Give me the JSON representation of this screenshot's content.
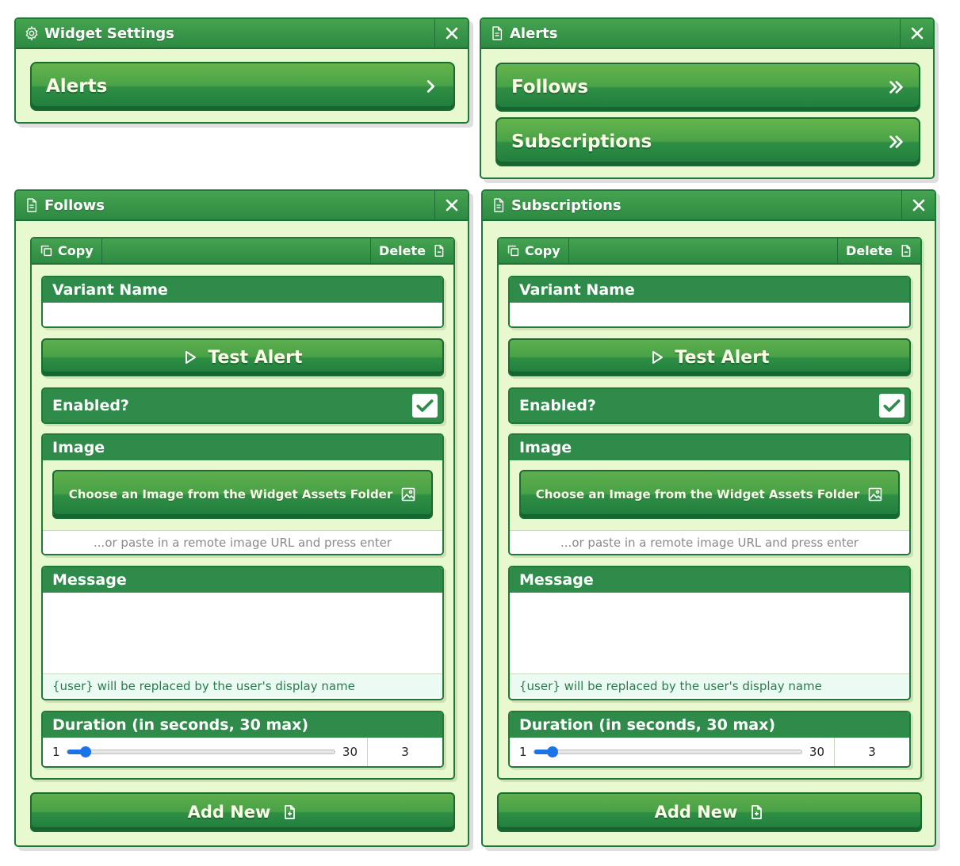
{
  "widget_settings": {
    "title": "Widget Settings",
    "title_icon": "gear-icon",
    "items": [
      {
        "label": "Alerts",
        "icon": "chevron-right-icon"
      }
    ]
  },
  "alerts": {
    "title": "Alerts",
    "title_icon": "document-icon",
    "items": [
      {
        "label": "Follows",
        "icon": "double-chevron-right-icon"
      },
      {
        "label": "Subscriptions",
        "icon": "double-chevron-right-icon"
      }
    ]
  },
  "editors": [
    {
      "title": "Follows",
      "title_icon": "document-icon",
      "copy_label": "Copy",
      "delete_label": "Delete",
      "variant_name_label": "Variant Name",
      "variant_name_value": "",
      "test_alert_label": "Test Alert",
      "enabled_label": "Enabled?",
      "enabled": true,
      "image_label": "Image",
      "choose_image_label": "Choose an Image from the Widget Assets Folder",
      "image_url_placeholder": "...or paste in a remote image URL and press enter",
      "message_label": "Message",
      "message_value": "",
      "message_hint": "{user} will be replaced by the user's display name",
      "duration_label": "Duration (in seconds, 30 max)",
      "duration_min": "1",
      "duration_max": "30",
      "duration_value": "3",
      "add_new_label": "Add New"
    },
    {
      "title": "Subscriptions",
      "title_icon": "document-icon",
      "copy_label": "Copy",
      "delete_label": "Delete",
      "variant_name_label": "Variant Name",
      "variant_name_value": "",
      "test_alert_label": "Test Alert",
      "enabled_label": "Enabled?",
      "enabled": true,
      "image_label": "Image",
      "choose_image_label": "Choose an Image from the Widget Assets Folder",
      "image_url_placeholder": "...or paste in a remote image URL and press enter",
      "message_label": "Message",
      "message_value": "",
      "message_hint": "{user} will be replaced by the user's display name",
      "duration_label": "Duration (in seconds, 30 max)",
      "duration_min": "1",
      "duration_max": "30",
      "duration_value": "3",
      "add_new_label": "Add New"
    }
  ],
  "colors": {
    "panel_background": "#e9f9cf",
    "header_green": "#2e8b4a",
    "border_green": "#1f7a3a",
    "slider_blue": "#1a73e8"
  }
}
